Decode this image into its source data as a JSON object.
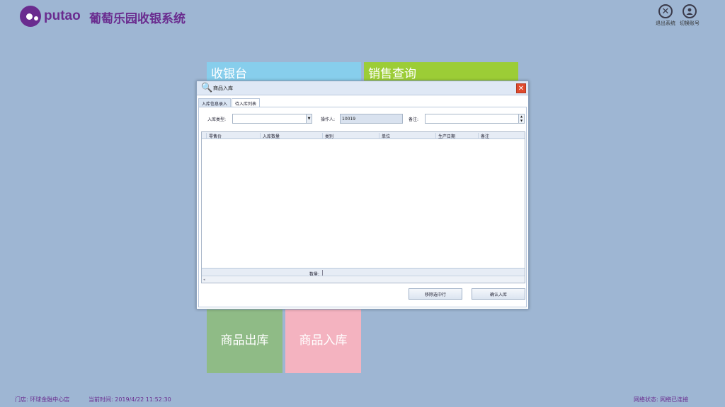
{
  "header": {
    "logo_text": "putao",
    "title": "葡萄乐园收银系统",
    "exit_label": "退出系统",
    "switch_label": "切换账号"
  },
  "tiles": {
    "cashier": "收银台",
    "sales_query": "销售查询",
    "stock_out": "商品出库",
    "stock_in": "商品入库"
  },
  "dialog": {
    "title": "商品入库",
    "tabs": [
      "入库信息录入",
      "待入库列表"
    ],
    "active_tab": 1,
    "form": {
      "type_label": "入库类型:",
      "type_value": "",
      "operator_label": "操作人:",
      "operator_value": "10019",
      "note_label": "备注:",
      "note_value": ""
    },
    "grid": {
      "columns": [
        "零售价",
        "入库数量",
        "类别",
        "单位",
        "生产日期",
        "备注"
      ],
      "rows": [],
      "footer_label": "数量:"
    },
    "buttons": {
      "remove": "移除选中行",
      "confirm": "确认入库"
    }
  },
  "footer": {
    "store": "门店: 环球金融中心店",
    "time": "当前时间: 2019/4/22 11:52:30",
    "network": "网络状态: 网络已连接"
  },
  "colors": {
    "background": "#9eb6d3",
    "brand": "#6a2c8f",
    "tile_cashier": "#87ceec",
    "tile_sales": "#9ccd36",
    "tile_out": "#8fbb86",
    "tile_in": "#f4b3c0"
  }
}
